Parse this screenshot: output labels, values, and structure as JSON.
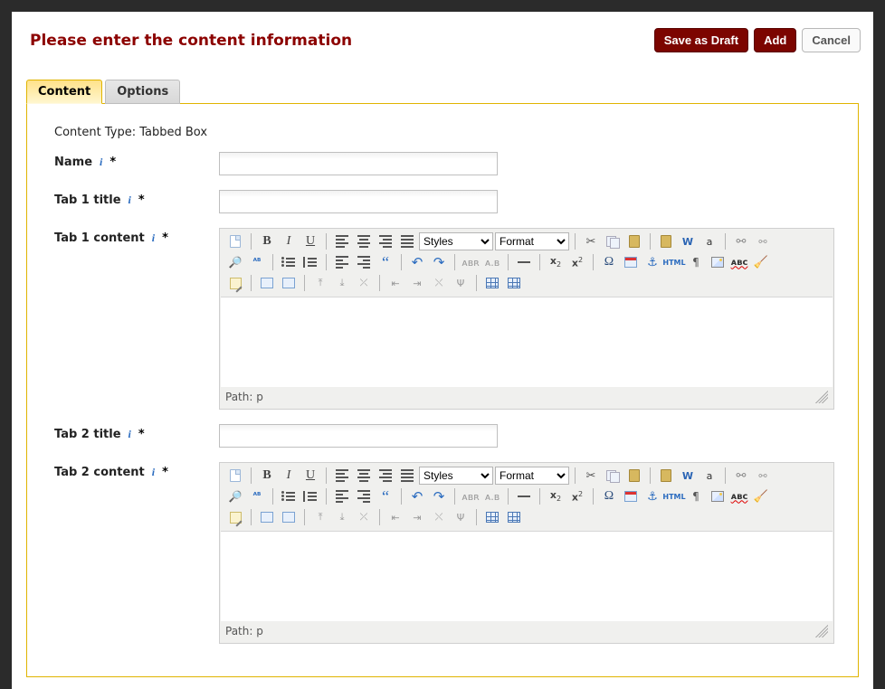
{
  "header": {
    "title": "Please enter the content information",
    "buttons": {
      "save_draft": "Save as Draft",
      "add": "Add",
      "cancel": "Cancel"
    }
  },
  "tabs": {
    "content": "Content",
    "options": "Options"
  },
  "content": {
    "content_type_label": "Content Type:",
    "content_type_value": "Tabbed Box",
    "fields": {
      "name": {
        "label": "Name"
      },
      "tab1_title": {
        "label": "Tab 1 title"
      },
      "tab1_content": {
        "label": "Tab 1 content"
      },
      "tab2_title": {
        "label": "Tab 2 title"
      },
      "tab2_content": {
        "label": "Tab 2 content"
      }
    },
    "required_mark": "*",
    "info_glyph": "i"
  },
  "rte": {
    "styles_select": "Styles",
    "format_select": "Format",
    "path_label": "Path:",
    "path_value": "p",
    "icons": {
      "newdoc": "New Document",
      "bold": "B",
      "italic": "I",
      "underline": "U",
      "align_left": "align-left",
      "align_center": "align-center",
      "align_right": "align-right",
      "align_full": "align-full",
      "cut": "✂",
      "copy": "copy",
      "paste": "paste",
      "paste_text": "T",
      "paste_word": "W",
      "paste_a": "a",
      "link": "🔗",
      "unlink": "⚯",
      "find": "🔍",
      "replace": "A/B",
      "ul": "ul",
      "ol": "ol",
      "outdent": "⇤",
      "indent": "⇥",
      "quote": "“",
      "undo": "↶",
      "redo": "↷",
      "abbr1": "ᴀʙʙʀ",
      "abbr2": "ᴀ.ʙ.ᴄ",
      "hr": "—",
      "sub": "x₂",
      "sup": "x²",
      "omega": "Ω",
      "date": "📅",
      "anchor": "⚓",
      "html": "HTML",
      "code": "¶",
      "image": "img",
      "spell": "ABC",
      "clean": "🧹",
      "editcss": "edit",
      "cell1": "cell",
      "cell2": "cell",
      "row1": "row",
      "row2": "row",
      "row3": "row",
      "col1": "col",
      "col2": "col",
      "col3": "col",
      "merge": "merge",
      "table": "table",
      "tableprops": "tprops"
    }
  }
}
